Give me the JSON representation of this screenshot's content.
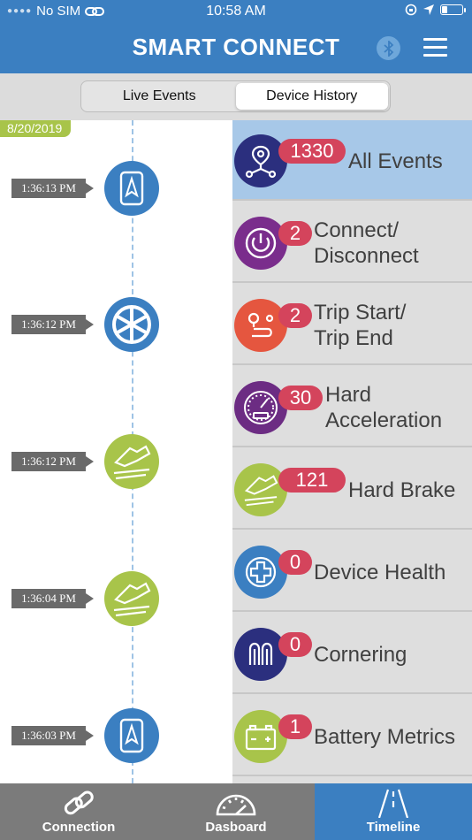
{
  "status_bar": {
    "carrier": "No SIM",
    "time": "10:58 AM"
  },
  "header": {
    "title": "SMART CONNECT"
  },
  "segments": {
    "live": "Live Events",
    "history": "Device History",
    "selected": "Device History"
  },
  "timeline": {
    "date": "8/20/2019",
    "items": [
      {
        "time": "1:36:13 PM",
        "icon": "phone-navigation-icon",
        "color": "#3b7fc1"
      },
      {
        "time": "1:36:12 PM",
        "icon": "wheel-icon",
        "color": "#3b7fc1"
      },
      {
        "time": "1:36:12 PM",
        "icon": "pedal-icon",
        "color": "#a8c44a"
      },
      {
        "time": "1:36:04 PM",
        "icon": "pedal-icon",
        "color": "#a8c44a"
      },
      {
        "time": "1:36:03 PM",
        "icon": "phone-navigation-icon",
        "color": "#3b7fc1"
      }
    ]
  },
  "events": [
    {
      "count": "1330",
      "label": [
        "All Events"
      ],
      "icon": "network-pin-icon",
      "color": "#2b2f7e",
      "selected": true
    },
    {
      "count": "2",
      "label": [
        "Connect/",
        "Disconnect"
      ],
      "icon": "power-icon",
      "color": "#7a2d8c"
    },
    {
      "count": "2",
      "label": [
        "Trip Start/",
        "Trip End"
      ],
      "icon": "route-icon",
      "color": "#e5563f"
    },
    {
      "count": "30",
      "label": [
        "Hard",
        "Acceleration"
      ],
      "icon": "speedometer-icon",
      "color": "#6c2c83"
    },
    {
      "count": "121",
      "label": [
        "Hard Brake"
      ],
      "icon": "pedal-icon",
      "color": "#a8c44a"
    },
    {
      "count": "0",
      "label": [
        "Device Health"
      ],
      "icon": "health-cross-icon",
      "color": "#3b7fc1"
    },
    {
      "count": "0",
      "label": [
        "Cornering"
      ],
      "icon": "cornering-icon",
      "color": "#2b2f7e"
    },
    {
      "count": "1",
      "label": [
        "Battery Metrics"
      ],
      "icon": "battery-icon",
      "color": "#a8c44a"
    }
  ],
  "tabbar": {
    "connection": "Connection",
    "dashboard": "Dasboard",
    "timeline": "Timeline",
    "active": "Timeline"
  }
}
